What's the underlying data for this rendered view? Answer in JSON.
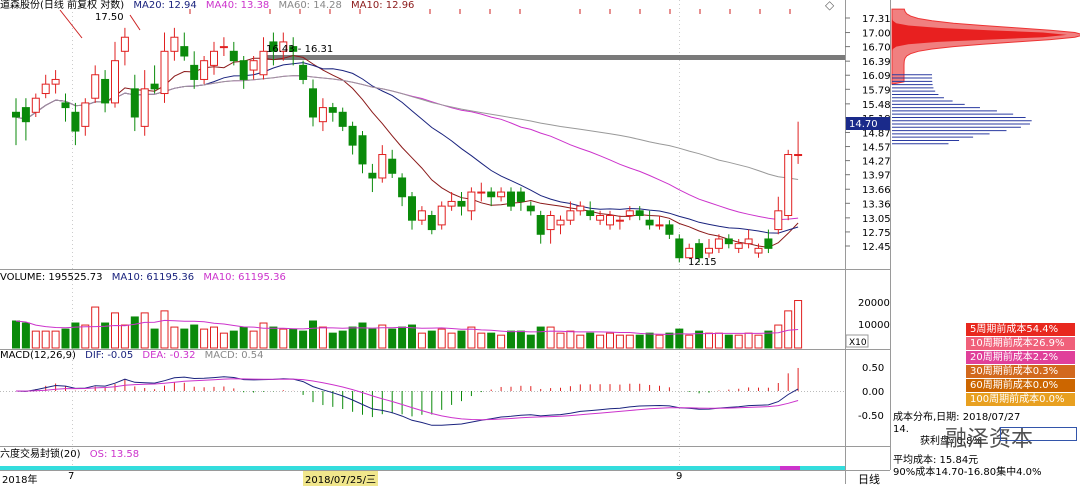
{
  "price_panel": {
    "title": "道森股份(日线 前复权 对数)",
    "ma20_label": "MA20: 12.94",
    "ma40_label": "MA40: 13.38",
    "ma60_label": "MA60: 14.28",
    "ma10_label": "MA10: 12.96",
    "annotation_high": "17.50",
    "annotation_range": "16.43 - 16.31",
    "annotation_low": "12.15",
    "current_price": "14.70",
    "y_ticks": [
      "17.31",
      "17.00",
      "16.70",
      "16.39",
      "16.09",
      "15.79",
      "15.48",
      "15.18",
      "14.87",
      "14.57",
      "14.27",
      "13.97",
      "13.66",
      "13.36",
      "13.05",
      "12.75",
      "12.45"
    ],
    "colors": {
      "up": "#e02020",
      "down": "#0a8a0a",
      "ma10": "#8b1a1a",
      "ma20": "#1a237e",
      "ma40": "#cc33cc",
      "ma60": "#999999"
    }
  },
  "volume_panel": {
    "volume_label": "VOLUME: 195525.73",
    "ma10_label": "MA10: 61195.36",
    "ma10b_label": "MA10: 61195.36",
    "y_ticks": [
      "20000",
      "10000"
    ],
    "unit": "X10"
  },
  "macd_panel": {
    "macd_label": "MACD(12,26,9)",
    "dif_label": "DIF: -0.05",
    "dea_label": "DEA: -0.32",
    "macd_value_label": "MACD: 0.54",
    "y_ticks": [
      "0.50",
      "0.00",
      "-0.50"
    ]
  },
  "bottom": {
    "indicator_label": "六度交易封锁(20)",
    "os_label": "OS: 13.58",
    "date_labels": [
      "2018年",
      "7",
      "2018/07/25/三",
      "9"
    ],
    "period": "日线"
  },
  "chip_panel": {
    "cycles": [
      {
        "label": "5周期前成本54.4%",
        "color": "#e8281e"
      },
      {
        "label": "10周期前成本26.9%",
        "color": "#f0607a"
      },
      {
        "label": "20周期前成本2.2%",
        "color": "#e0409a"
      },
      {
        "label": "30周期前成本0.3%",
        "color": "#d2691e"
      },
      {
        "label": "60周期前成本0.0%",
        "color": "#cc6600"
      },
      {
        "label": "100周期前成本0.0%",
        "color": "#e8a020"
      }
    ],
    "date_line": "成本分布,日期: 2018/07/27",
    "line2": "14.",
    "line3": "获利盘: 0.8%",
    "avg_cost": "平均成本: 15.84元",
    "range": "90%成本14.70-16.80集中4.0%",
    "watermark": "融泽资本"
  },
  "chart_data": {
    "type": "candlestick",
    "title": "道森股份(日线 前复权 对数)",
    "ylim": [
      12.2,
      17.5
    ],
    "candles": [
      [
        15.3,
        15.2,
        15.6,
        14.6
      ],
      [
        15.4,
        15.1,
        15.6,
        14.7
      ],
      [
        15.3,
        15.6,
        15.7,
        15.2
      ],
      [
        15.7,
        15.9,
        16.1,
        15.6
      ],
      [
        15.9,
        16.0,
        16.2,
        15.7
      ],
      [
        15.5,
        15.4,
        15.7,
        15.1
      ],
      [
        15.3,
        14.9,
        15.5,
        14.6
      ],
      [
        15.0,
        15.5,
        15.6,
        14.8
      ],
      [
        15.6,
        16.1,
        16.3,
        15.5
      ],
      [
        16.0,
        15.5,
        16.2,
        15.3
      ],
      [
        15.5,
        16.4,
        16.8,
        15.4
      ],
      [
        16.6,
        16.9,
        17.1,
        16.3
      ],
      [
        15.8,
        15.2,
        16.1,
        14.9
      ],
      [
        15.0,
        15.8,
        16.2,
        14.8
      ],
      [
        15.9,
        15.8,
        16.3,
        15.7
      ],
      [
        15.7,
        16.6,
        17.0,
        15.5
      ],
      [
        16.6,
        16.9,
        17.1,
        16.4
      ],
      [
        16.7,
        16.5,
        17.0,
        16.4
      ],
      [
        16.3,
        16.0,
        16.6,
        15.8
      ],
      [
        16.0,
        16.4,
        16.5,
        15.9
      ],
      [
        16.3,
        16.6,
        16.8,
        16.1
      ],
      [
        16.7,
        16.7,
        16.9,
        16.5
      ],
      [
        16.6,
        16.4,
        16.8,
        16.3
      ],
      [
        16.4,
        16.0,
        16.5,
        15.8
      ],
      [
        16.2,
        16.4,
        16.5,
        16.0
      ],
      [
        16.1,
        16.6,
        16.9,
        16.0
      ],
      [
        16.8,
        16.6,
        17.0,
        16.3
      ],
      [
        16.6,
        16.8,
        17.0,
        16.4
      ],
      [
        16.7,
        16.6,
        16.9,
        16.3
      ],
      [
        16.3,
        16.0,
        16.4,
        15.9
      ],
      [
        15.8,
        15.2,
        16.0,
        15.0
      ],
      [
        15.1,
        15.4,
        15.6,
        14.9
      ],
      [
        15.4,
        15.3,
        15.5,
        15.1
      ],
      [
        15.3,
        15.0,
        15.4,
        14.9
      ],
      [
        15.0,
        14.6,
        15.1,
        14.4
      ],
      [
        14.8,
        14.2,
        14.9,
        14.0
      ],
      [
        14.0,
        13.9,
        14.2,
        13.6
      ],
      [
        13.9,
        14.4,
        14.6,
        13.8
      ],
      [
        14.3,
        14.0,
        14.5,
        13.9
      ],
      [
        13.9,
        13.5,
        14.0,
        13.3
      ],
      [
        13.5,
        13.0,
        13.6,
        12.8
      ],
      [
        13.0,
        13.2,
        13.3,
        12.9
      ],
      [
        13.1,
        12.8,
        13.2,
        12.7
      ],
      [
        12.9,
        13.3,
        13.4,
        12.8
      ],
      [
        13.3,
        13.4,
        13.6,
        13.2
      ],
      [
        13.4,
        13.3,
        13.6,
        13.1
      ],
      [
        13.2,
        13.6,
        13.7,
        13.0
      ],
      [
        13.6,
        13.6,
        13.8,
        13.4
      ],
      [
        13.6,
        13.5,
        13.7,
        13.3
      ],
      [
        13.5,
        13.6,
        13.7,
        13.4
      ],
      [
        13.6,
        13.3,
        13.7,
        13.2
      ],
      [
        13.6,
        13.4,
        13.7,
        13.2
      ],
      [
        13.3,
        13.2,
        13.4,
        13.1
      ],
      [
        13.1,
        12.7,
        13.2,
        12.5
      ],
      [
        12.8,
        13.1,
        13.2,
        12.5
      ],
      [
        12.9,
        13.0,
        13.1,
        12.7
      ],
      [
        13.0,
        13.2,
        13.4,
        12.9
      ],
      [
        13.2,
        13.3,
        13.4,
        13.1
      ],
      [
        13.2,
        13.1,
        13.4,
        13.0
      ],
      [
        13.0,
        13.1,
        13.2,
        12.9
      ],
      [
        12.9,
        13.1,
        13.2,
        12.8
      ],
      [
        13.0,
        13.0,
        13.1,
        12.8
      ],
      [
        13.1,
        13.2,
        13.3,
        13.0
      ],
      [
        13.2,
        13.1,
        13.3,
        13.0
      ],
      [
        13.0,
        12.9,
        13.2,
        12.8
      ],
      [
        12.9,
        12.9,
        13.1,
        12.8
      ],
      [
        12.9,
        12.7,
        13.0,
        12.6
      ],
      [
        12.6,
        12.2,
        12.7,
        12.1
      ],
      [
        12.2,
        12.4,
        12.5,
        12.2
      ],
      [
        12.5,
        12.2,
        12.6,
        12.1
      ],
      [
        12.3,
        12.4,
        12.6,
        12.2
      ],
      [
        12.4,
        12.6,
        12.7,
        12.3
      ],
      [
        12.6,
        12.5,
        12.7,
        12.4
      ],
      [
        12.4,
        12.5,
        12.6,
        12.3
      ],
      [
        12.5,
        12.6,
        12.8,
        12.4
      ],
      [
        12.3,
        12.4,
        12.5,
        12.2
      ],
      [
        12.6,
        12.4,
        12.8,
        12.3
      ],
      [
        12.8,
        13.2,
        13.5,
        12.7
      ],
      [
        13.1,
        14.4,
        14.5,
        13.0
      ],
      [
        14.4,
        14.4,
        15.1,
        14.2
      ]
    ]
  }
}
